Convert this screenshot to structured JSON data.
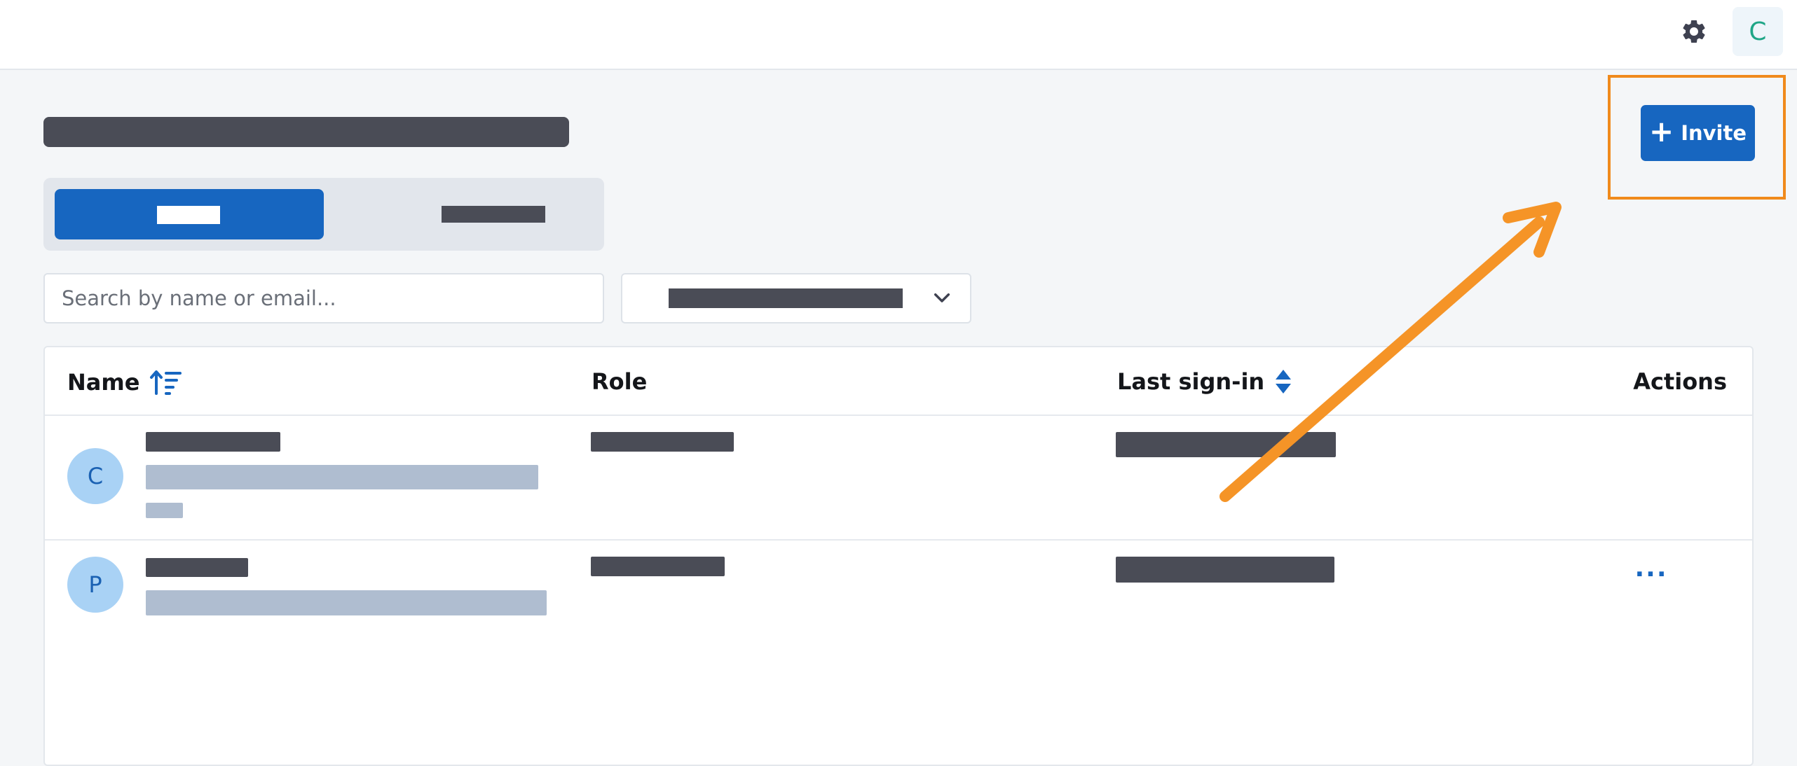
{
  "topbar": {
    "user_initial": "C"
  },
  "toolbar": {
    "invite_label": "Invite",
    "invite_plus": "+"
  },
  "filters": {
    "search_placeholder": "Search by name or email..."
  },
  "table": {
    "columns": {
      "name": "Name",
      "role": "Role",
      "last_signin": "Last sign-in",
      "actions": "Actions"
    },
    "rows": [
      {
        "avatar_initial": "C"
      },
      {
        "avatar_initial": "P",
        "actions_label": "..."
      }
    ]
  },
  "icons": {
    "settings": "gear-icon",
    "sort_name": "sort-ascending-icon",
    "sort_last_signin": "sort-both-icon",
    "select_chevron": "chevron-down-icon",
    "more_actions": "ellipsis-icon",
    "annotation": "arrow-annotation"
  },
  "colors": {
    "accent": "#1766c0",
    "highlight": "#f08a1c",
    "avatar_bg": "#a9d2f5",
    "user_avatar_text": "#1fa687"
  }
}
